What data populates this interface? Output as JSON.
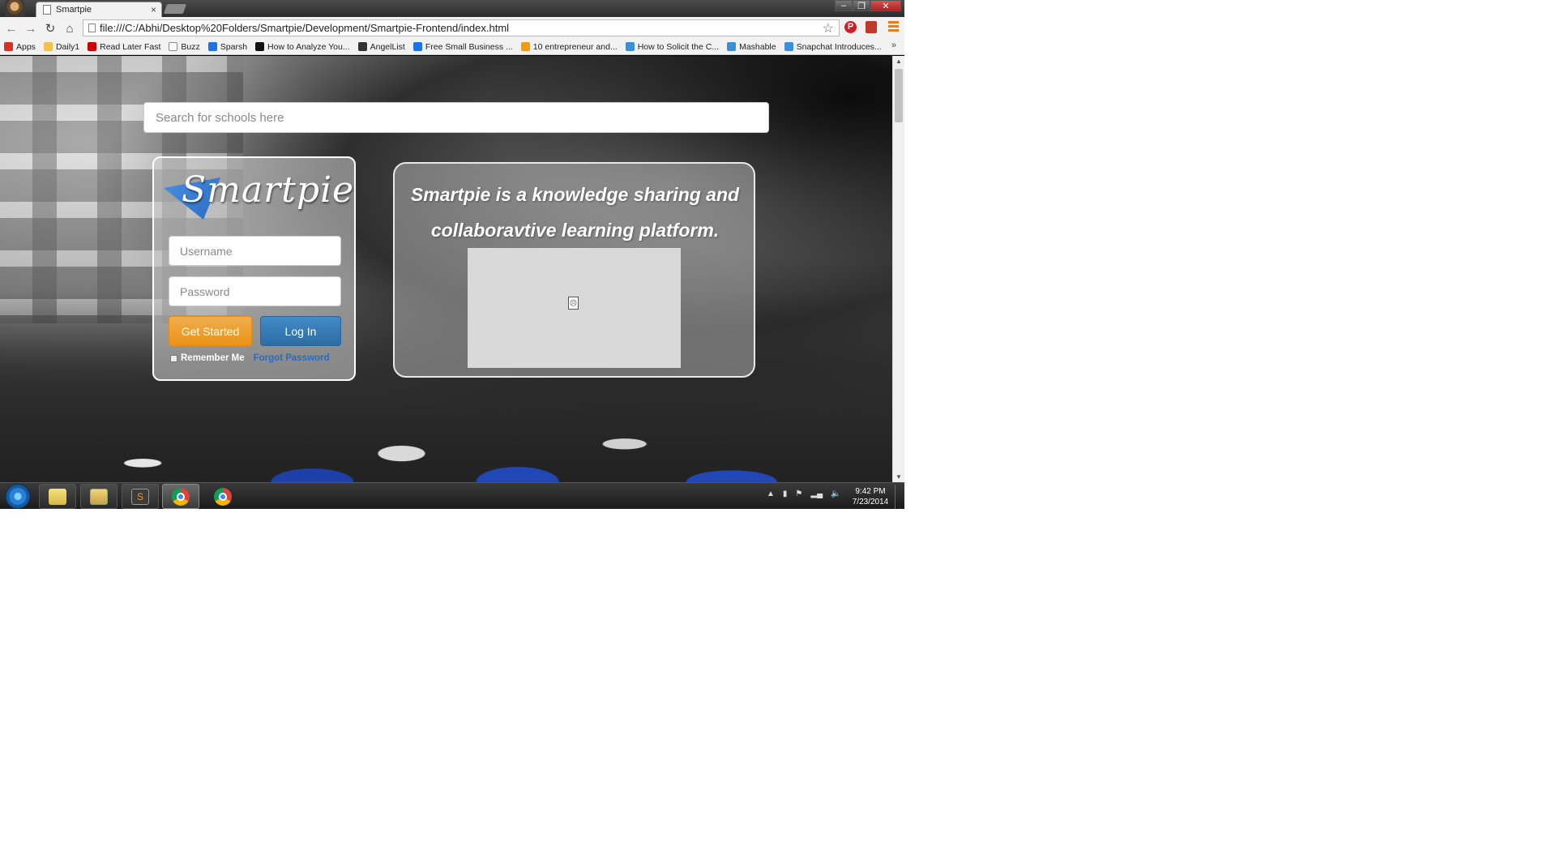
{
  "browser": {
    "tab_title": "Smartpie",
    "tab_close": "×",
    "url": "file:///C:/Abhi/Desktop%20Folders/Smartpie/Development/Smartpie-Frontend/index.html",
    "bookmarks": [
      {
        "label": "Apps",
        "icon": "apps-grid-icon",
        "color": "#d93025"
      },
      {
        "label": "Daily1",
        "icon": "folder-icon",
        "color": "#f2c14e"
      },
      {
        "label": "Read Later Fast",
        "icon": "bookmark-icon",
        "color": "#cc0000"
      },
      {
        "label": "Buzz",
        "icon": "page-icon",
        "color": "#ffffff"
      },
      {
        "label": "Sparsh",
        "icon": "s-icon",
        "color": "#1a73e8"
      },
      {
        "label": "How to Analyze You...",
        "icon": "circle-icon",
        "color": "#111111"
      },
      {
        "label": "AngelList",
        "icon": "peace-icon",
        "color": "#333333"
      },
      {
        "label": "Free Small Business ...",
        "icon": "s-icon",
        "color": "#1a73e8"
      },
      {
        "label": "10 entrepreneur and...",
        "icon": "flame-icon",
        "color": "#f39c12"
      },
      {
        "label": "How to Solicit the C...",
        "icon": "m-icon",
        "color": "#3b8fd6"
      },
      {
        "label": "Mashable",
        "icon": "m-icon",
        "color": "#3b8fd6"
      },
      {
        "label": "Snapchat Introduces...",
        "icon": "m-icon",
        "color": "#3b8fd6"
      }
    ],
    "bookmarks_more": "»"
  },
  "page": {
    "search_placeholder": "Search for schools here",
    "logo_text": "Smartpie",
    "username_placeholder": "Username",
    "password_placeholder": "Password",
    "get_started_label": "Get Started",
    "login_label": "Log In",
    "remember_label": "Remember Me",
    "forgot_label": "Forgot Password",
    "tagline": "Smartpie is a knowledge sharing and collaboravtive learning platform.",
    "colors": {
      "get_started": "#f0ad4e",
      "login": "#428bca",
      "forgot_link": "#2a6bc0"
    }
  },
  "taskbar": {
    "time": "9:42 PM",
    "date": "7/23/2014"
  }
}
